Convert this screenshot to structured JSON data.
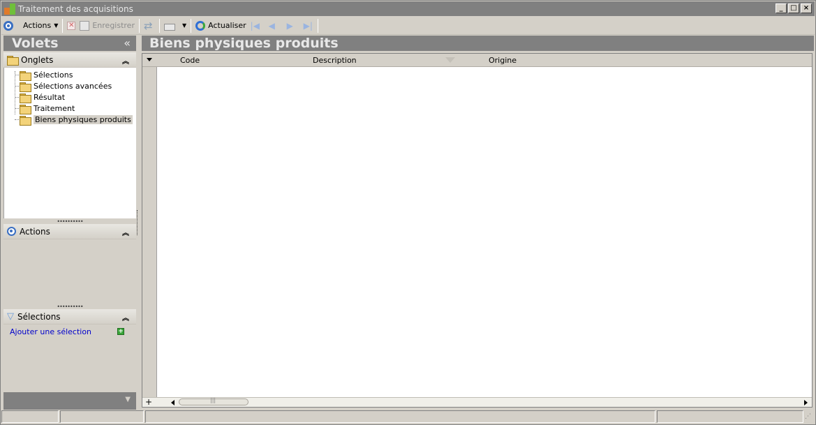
{
  "window": {
    "title": "Traitement des acquisitions",
    "min": "_",
    "max": "□",
    "close": "×"
  },
  "toolbar": {
    "actions_label": "Actions",
    "save_label": "Enregistrer",
    "refresh_label": "Actualiser"
  },
  "left": {
    "header": "Volets",
    "collapse_glyph": "«",
    "tabs": {
      "title": "Onglets",
      "items": [
        "Sélections",
        "Sélections avancées",
        "Résultat",
        "Traitement",
        "Biens physiques produits"
      ]
    },
    "actions": {
      "title": "Actions"
    },
    "selections": {
      "title": "Sélections",
      "add_link": "Ajouter une sélection"
    }
  },
  "main": {
    "title": "Biens physiques produits",
    "columns": [
      "Code",
      "Description",
      "Origine"
    ]
  },
  "colors": {
    "header_gray": "#808080",
    "panel": "#d4d0c8",
    "link": "#0000cc",
    "accent_blue": "#3a6fc2"
  },
  "icons": [
    "app-icon",
    "actions-ring-icon",
    "delete-icon",
    "save-icon",
    "sync-icon",
    "print-icon",
    "refresh-icon",
    "first-icon",
    "prev-icon",
    "next-icon",
    "last-icon",
    "folder-icon",
    "filter-icon",
    "add-icon"
  ]
}
